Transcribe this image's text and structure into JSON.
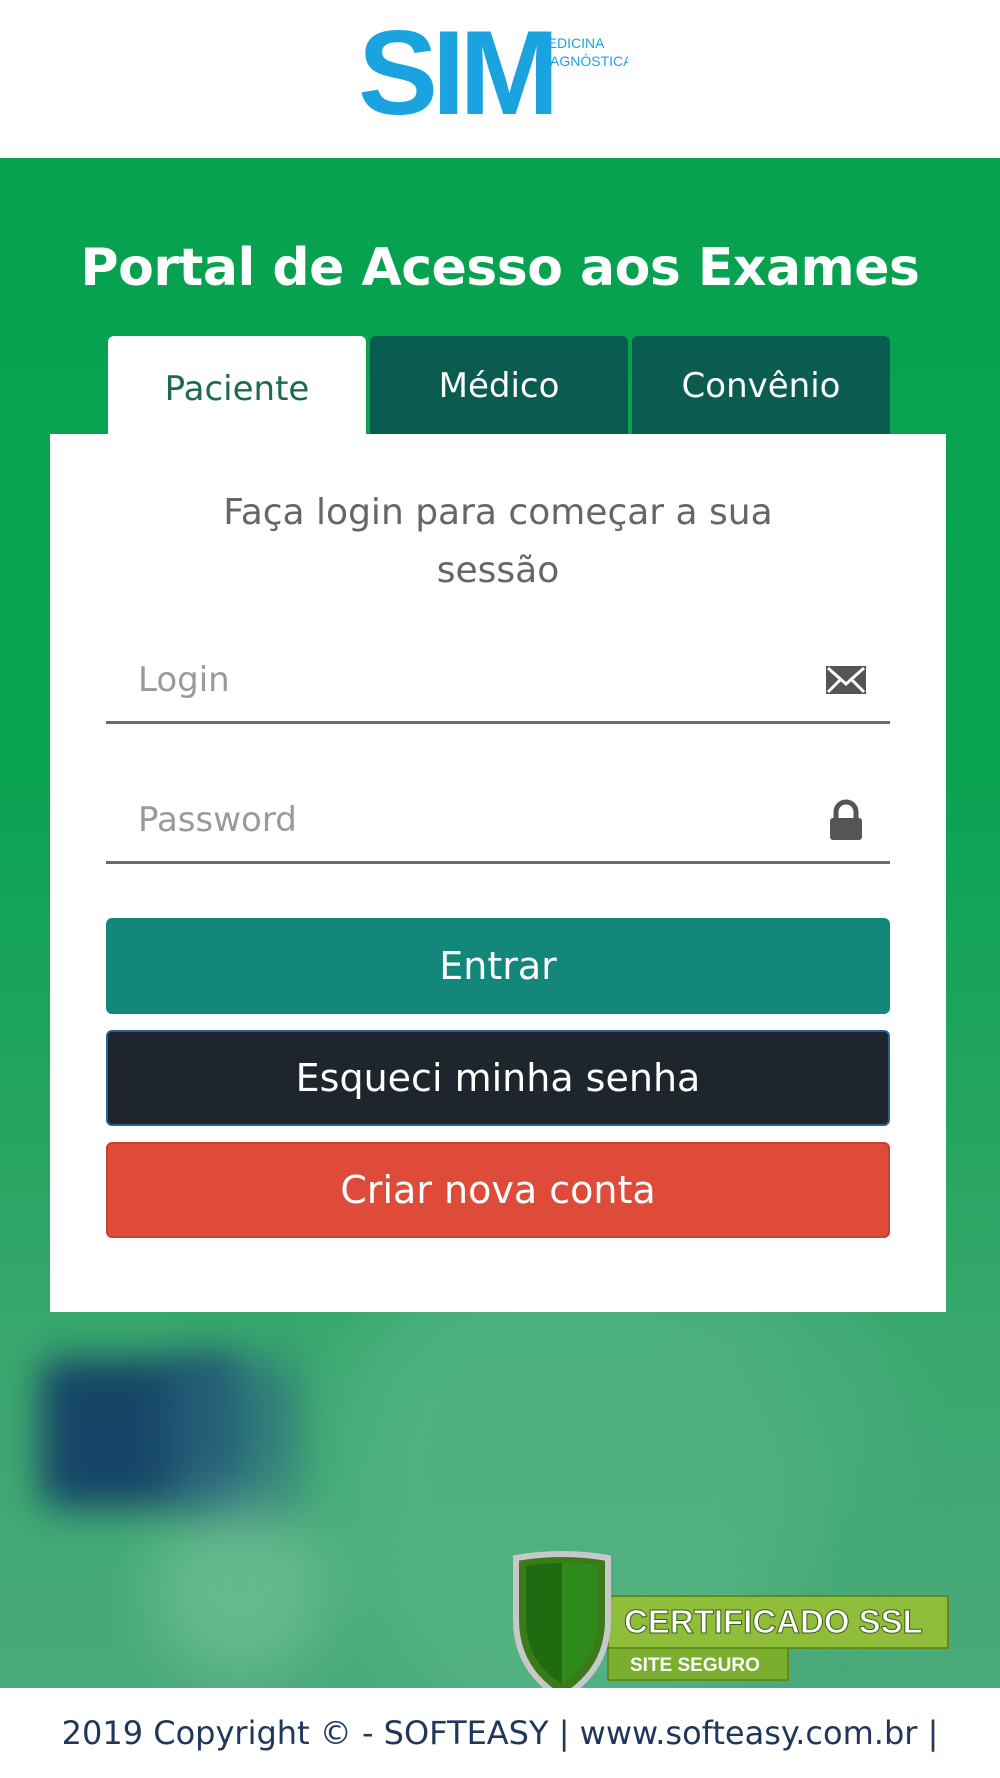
{
  "logo": {
    "brand": "SIM",
    "tagline_line1": "MEDICINA",
    "tagline_line2": "DIAGNÓSTICA"
  },
  "portal": {
    "title": "Portal de Acesso aos Exames"
  },
  "tabs": [
    {
      "label": "Paciente",
      "active": true
    },
    {
      "label": "Médico",
      "active": false
    },
    {
      "label": "Convênio",
      "active": false
    }
  ],
  "login_form": {
    "subtitle_line1": "Faça login para começar a sua",
    "subtitle_line2": "sessão",
    "login_placeholder": "Login",
    "login_icon": "envelope-icon",
    "password_placeholder": "Password",
    "password_icon": "lock-icon",
    "submit_label": "Entrar",
    "forgot_label": "Esqueci minha senha",
    "create_account_label": "Criar nova conta"
  },
  "ssl_badge": {
    "title": "CERTIFICADO SSL",
    "subtitle": "SITE SEGURO"
  },
  "footer": {
    "copyright": "2019 Copyright © - SOFTEASY |",
    "link": "www.softeasy.com.br",
    "trailing": "|"
  },
  "colors": {
    "brand_blue": "#1ba3e0",
    "hero_green": "#06a24f",
    "tab_inactive": "#0b5c50",
    "button_primary": "#12877a",
    "button_dark": "#1e252c",
    "button_danger": "#de4b38"
  }
}
